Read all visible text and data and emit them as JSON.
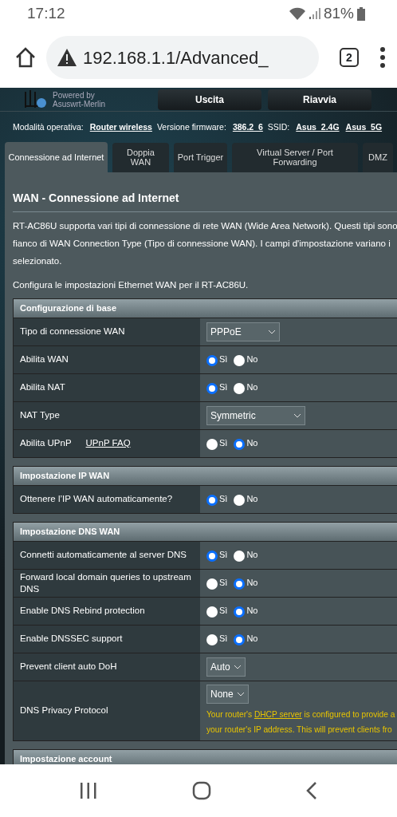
{
  "status_bar": {
    "time": "17:12",
    "battery": "81%"
  },
  "browser": {
    "url": "192.168.1.1/Advanced_",
    "tab_count": "2"
  },
  "header": {
    "logo_lines": [
      "Powered by",
      "Asuswrt-Merlin"
    ],
    "buttons": [
      "Uscita",
      "Riavvia"
    ]
  },
  "info_bar": [
    {
      "label": "Modalità operativa:",
      "links": [
        "Router wireless"
      ]
    },
    {
      "label": "Versione firmware:",
      "links": [
        "386.2_6"
      ]
    },
    {
      "label": "SSID:",
      "links": [
        "Asus_2.4G",
        "Asus_5G"
      ]
    }
  ],
  "tabs": [
    {
      "label": "Connessione ad Internet",
      "selected": true
    },
    {
      "label": "Doppia WAN",
      "selected": false
    },
    {
      "label": "Port Trigger",
      "selected": false
    },
    {
      "label": "Virtual Server / Port Forwarding",
      "selected": false
    },
    {
      "label": "DMZ",
      "selected": false
    }
  ],
  "title": "WAN - Connessione ad Internet",
  "intro_lines": [
    "RT-AC86U supporta vari tipi di connessione di rete WAN (Wide Area Network). Questi tipi sono",
    "fianco di WAN Connection Type (Tipo di connessione WAN). I campi d'impostazione variano i",
    "selezionato."
  ],
  "intro_note": "Configura le impostazioni Ethernet WAN per il RT-AC86U.",
  "sections": [
    {
      "title": "Configurazione di base",
      "rows": [
        {
          "label": "Tipo di connessione WAN",
          "kind": "select",
          "value": "PPPoE"
        },
        {
          "label": "Abilita WAN",
          "kind": "radio",
          "options": [
            {
              "label": "Sì",
              "selected": true
            },
            {
              "label": "No",
              "selected": false
            }
          ]
        },
        {
          "label": "Abilita NAT",
          "kind": "radio",
          "options": [
            {
              "label": "Sì",
              "selected": true
            },
            {
              "label": "No",
              "selected": false
            }
          ]
        },
        {
          "label": "NAT Type",
          "kind": "select",
          "value": "Symmetric"
        },
        {
          "label": "Abilita UPnP",
          "link": "UPnP FAQ",
          "kind": "radio",
          "options": [
            {
              "label": "Sì",
              "selected": false
            },
            {
              "label": "No",
              "selected": true
            }
          ]
        }
      ]
    },
    {
      "title": "Impostazione IP WAN",
      "rows": [
        {
          "label": "Ottenere l’IP WAN automaticamente?",
          "kind": "radio",
          "options": [
            {
              "label": "Sì",
              "selected": true
            },
            {
              "label": "No",
              "selected": false
            }
          ]
        }
      ]
    },
    {
      "title": "Impostazione DNS WAN",
      "rows": [
        {
          "label": "Connetti automaticamente al server DNS",
          "kind": "radio",
          "options": [
            {
              "label": "Sì",
              "selected": true
            },
            {
              "label": "No",
              "selected": false
            }
          ]
        },
        {
          "label": "Forward local domain queries to upstream DNS",
          "kind": "radio",
          "options": [
            {
              "label": "Sì",
              "selected": false
            },
            {
              "label": "No",
              "selected": true
            }
          ]
        },
        {
          "label": "Enable DNS Rebind protection",
          "kind": "radio",
          "options": [
            {
              "label": "Sì",
              "selected": false
            },
            {
              "label": "No",
              "selected": true
            }
          ]
        },
        {
          "label": "Enable DNSSEC support",
          "kind": "radio",
          "options": [
            {
              "label": "Sì",
              "selected": false
            },
            {
              "label": "No",
              "selected": true
            }
          ]
        },
        {
          "label": "Prevent client auto DoH",
          "kind": "select",
          "value": "Auto"
        },
        {
          "label": "DNS Privacy Protocol",
          "kind": "select",
          "value": "None",
          "note": {
            "before": "Your router's ",
            "link": "DHCP server",
            "after": " is configured to provide a",
            "line2": "your router's IP address. This will prevent clients fro"
          }
        }
      ]
    },
    {
      "title": "Impostazione account"
    }
  ]
}
